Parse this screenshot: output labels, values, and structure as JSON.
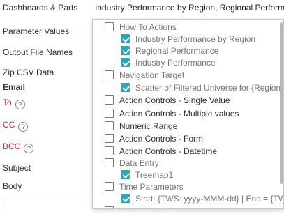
{
  "form": {
    "labels": {
      "dashboards_parts": "Dashboards & Parts",
      "parameter_values": "Parameter Values",
      "output_file_names": "Output File Names",
      "zip_csv_data": "Zip CSV Data",
      "email": "Email",
      "to": "To",
      "cc": "CC",
      "bcc": "BCC",
      "subject": "Subject",
      "body": "Body"
    },
    "help_glyph": "?",
    "dashboards_parts_value": "Industry Performance by Region, Regional Performance, Industry Performance"
  },
  "dropdown": {
    "items": [
      {
        "label": "How To Actions",
        "checked": false,
        "kind": "group"
      },
      {
        "label": "Industry Performance by Region",
        "checked": true,
        "kind": "sub"
      },
      {
        "label": "Regional Performance",
        "checked": true,
        "kind": "sub"
      },
      {
        "label": "Industry Performance",
        "checked": true,
        "kind": "sub"
      },
      {
        "label": "Navigation Target",
        "checked": false,
        "kind": "group"
      },
      {
        "label": "Scatter of Filtered Universe for {Region:",
        "checked": true,
        "kind": "sub"
      },
      {
        "label": "Action Controls - Single Value",
        "checked": false,
        "kind": "item"
      },
      {
        "label": "Action Controls - Multiple values",
        "checked": false,
        "kind": "item"
      },
      {
        "label": "Numeric Range",
        "checked": false,
        "kind": "item"
      },
      {
        "label": "Action Controls - Form",
        "checked": false,
        "kind": "item"
      },
      {
        "label": "Action Controls - Datetime",
        "checked": false,
        "kind": "item"
      },
      {
        "label": "Data Entry",
        "checked": false,
        "kind": "group"
      },
      {
        "label": "Treemap1",
        "checked": true,
        "kind": "sub"
      },
      {
        "label": "Time Parameters",
        "checked": false,
        "kind": "group"
      },
      {
        "label": "Start: {TWS: yyyy-MMM-dd} | End = {TWE: yyyy-MMM-dd}",
        "checked": true,
        "kind": "sub"
      },
      {
        "label": "Data-driven Parameters",
        "checked": false,
        "kind": "item"
      }
    ]
  },
  "colors": {
    "accent_check": "#2aa7b8",
    "required_label": "#cc3333"
  }
}
